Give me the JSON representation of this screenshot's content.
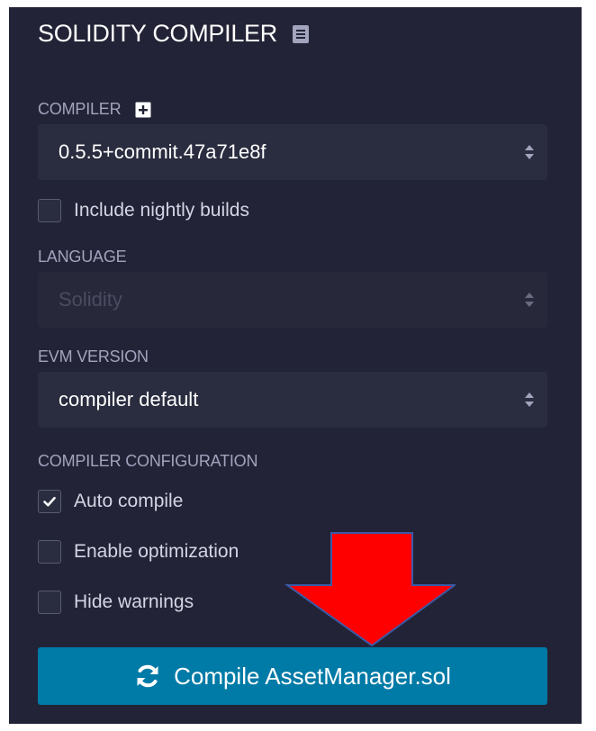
{
  "panel": {
    "title": "SOLIDITY COMPILER",
    "title_icon": "book-icon"
  },
  "compiler": {
    "label": "COMPILER",
    "add_icon": "plus-square-icon",
    "selected": "0.5.5+commit.47a71e8f"
  },
  "nightly": {
    "label": "Include nightly builds",
    "checked": false
  },
  "language": {
    "label": "LANGUAGE",
    "selected": "Solidity",
    "disabled": true
  },
  "evm": {
    "label": "EVM VERSION",
    "selected": "compiler default"
  },
  "config": {
    "label": "COMPILER CONFIGURATION",
    "options": [
      {
        "label": "Auto compile",
        "checked": true
      },
      {
        "label": "Enable optimization",
        "checked": false
      },
      {
        "label": "Hide warnings",
        "checked": false
      }
    ]
  },
  "compile_button": {
    "label": "Compile AssetManager.sol",
    "icon": "refresh-icon"
  },
  "annotation": {
    "shape": "down-arrow",
    "color": "#ff0000"
  },
  "colors": {
    "panel_bg": "#222336",
    "input_bg": "#2a2c3f",
    "label": "#a2a3bd",
    "button": "#007aa6"
  }
}
